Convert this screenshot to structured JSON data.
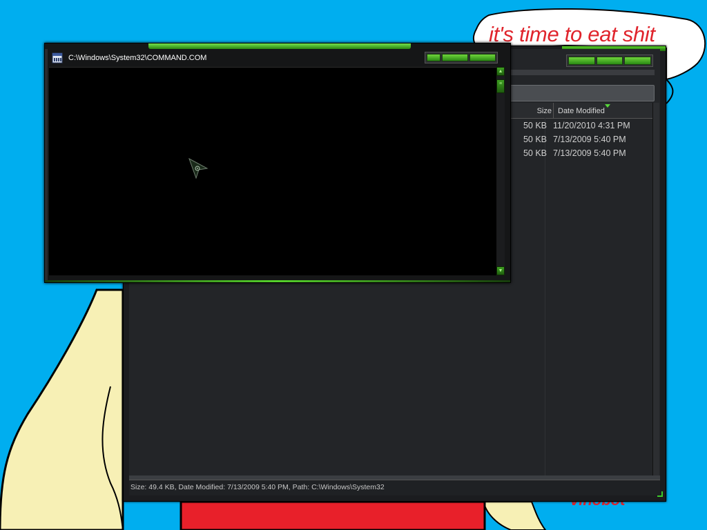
{
  "background": {
    "color": "#00aeef",
    "speech_bubble_text": "it's time to eat shit",
    "signature_text": "vinobot",
    "drawing_colors": {
      "skin": "#f7f0b5",
      "shirt": "#e8202a",
      "text": "#e0242c"
    }
  },
  "explorer_window": {
    "columns": {
      "size": "Size",
      "date_modified": "Date Modified"
    },
    "rows": [
      {
        "size": "50 KB",
        "date": "11/20/2010 4:31 PM"
      },
      {
        "size": "50 KB",
        "date": "7/13/2009 5:40 PM"
      },
      {
        "size": "50 KB",
        "date": "7/13/2009 5:40 PM"
      }
    ],
    "status_text": "Size: 49.4 KB, Date Modified: 7/13/2009 5:40 PM, Path: C:\\Windows\\System32"
  },
  "command_window": {
    "title": "C:\\Windows\\System32\\COMMAND.COM",
    "icon": "command-prompt-icon"
  },
  "colors": {
    "accent_green": "#5bd12a",
    "window_dark": "#1b1c1f",
    "console_black": "#000000"
  }
}
